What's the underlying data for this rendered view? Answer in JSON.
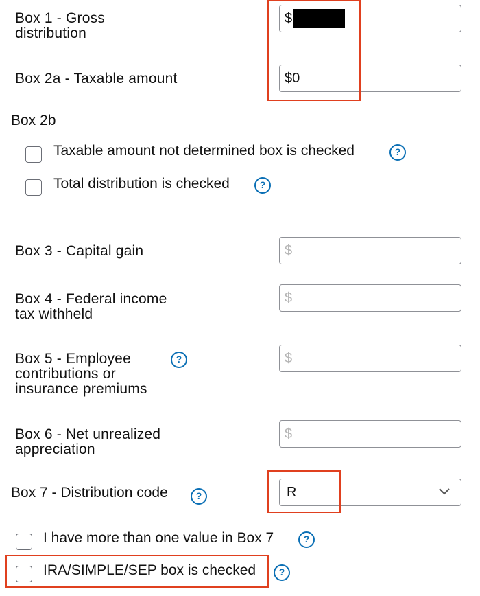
{
  "boxes": {
    "box1": {
      "label_line1": "Box 1 - Gross",
      "label_line2": "distribution",
      "value": "$"
    },
    "box2a": {
      "label": "Box 2a - Taxable amount",
      "value": "$0"
    },
    "box2b": {
      "heading": "Box 2b",
      "not_determined_label": "Taxable amount not determined box is checked",
      "total_distribution_label": "Total distribution is checked"
    },
    "box3": {
      "label": "Box 3 - Capital gain",
      "placeholder": "$"
    },
    "box4": {
      "label_line1": "Box 4 - Federal income",
      "label_line2": "tax withheld",
      "placeholder": "$"
    },
    "box5": {
      "label_line1": "Box 5 - Employee",
      "label_line2": "contributions or",
      "label_line3": "insurance premiums",
      "placeholder": "$"
    },
    "box6": {
      "label_line1": "Box 6 - Net unrealized",
      "label_line2": "appreciation",
      "placeholder": "$"
    },
    "box7": {
      "label": "Box 7 - Distribution code",
      "selected": "R",
      "multiple_values_label": "I have more than one value in Box 7",
      "ira_label": "IRA/SIMPLE/SEP box is checked"
    }
  },
  "help_glyph": "?",
  "colors": {
    "accent": "#0a6fb5",
    "highlight": "#e0401f",
    "redaction": "#000000"
  }
}
